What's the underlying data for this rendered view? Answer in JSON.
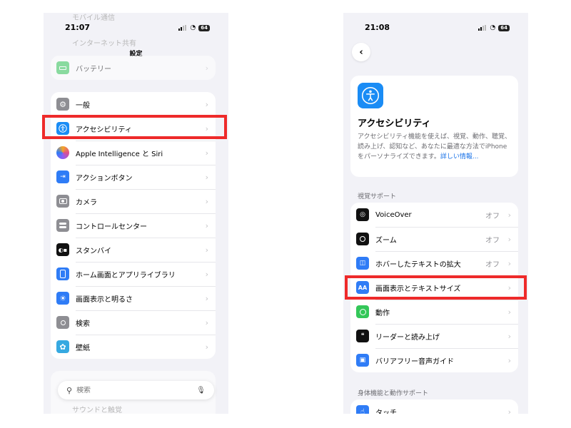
{
  "left_phone": {
    "status": {
      "time": "21:07",
      "battery": "64"
    },
    "faded_top": [
      "モバイル通信",
      "インターネット共有"
    ],
    "title": "設定",
    "battery_row": {
      "label": "バッテリー"
    },
    "groups": [
      {
        "label": "一般",
        "icon": "gear-icon",
        "color": "#8e8e93"
      },
      {
        "label": "アクセシビリティ",
        "icon": "accessibility-icon",
        "color": "#1a8cf5"
      },
      {
        "label": "Apple Intelligence と Siri",
        "icon": "siri-icon",
        "color": "#e04e8a"
      },
      {
        "label": "アクションボタン",
        "icon": "action-button-icon",
        "color": "#2f7cf6"
      },
      {
        "label": "カメラ",
        "icon": "camera-icon",
        "color": "#8e8e93"
      },
      {
        "label": "コントロールセンター",
        "icon": "control-center-icon",
        "color": "#8e8e93"
      },
      {
        "label": "スタンバイ",
        "icon": "standby-icon",
        "color": "#111111"
      },
      {
        "label": "ホーム画面とアプリライブラリ",
        "icon": "home-screen-icon",
        "color": "#2f7cf6"
      },
      {
        "label": "画面表示と明るさ",
        "icon": "brightness-icon",
        "color": "#2f7cf6"
      },
      {
        "label": "検索",
        "icon": "search-icon",
        "color": "#8e8e93"
      },
      {
        "label": "壁紙",
        "icon": "wallpaper-icon",
        "color": "#36a9e1"
      }
    ],
    "search": {
      "placeholder": "検索"
    },
    "faded_bottom": "サウンドと触覚"
  },
  "right_phone": {
    "status": {
      "time": "21:08",
      "battery": "64"
    },
    "hero": {
      "title": "アクセシビリティ",
      "description": "アクセシビリティ機能を使えば、視覚、動作、聴覚、読み上げ、認知など、あなたに最適な方法でiPhoneをパーソナライズできます。",
      "link": "詳しい情報..."
    },
    "vision_section": "視覚サポート",
    "vision_items": [
      {
        "label": "VoiceOver",
        "value": "オフ",
        "icon": "voiceover-icon",
        "color": "#111111"
      },
      {
        "label": "ズーム",
        "value": "オフ",
        "icon": "zoom-icon",
        "color": "#111111"
      },
      {
        "label": "ホバーしたテキストの拡大",
        "value": "オフ",
        "icon": "hover-text-icon",
        "color": "#2f7cf6"
      },
      {
        "label": "画面表示とテキストサイズ",
        "value": "",
        "icon": "text-size-icon",
        "color": "#2f7cf6"
      },
      {
        "label": "動作",
        "value": "",
        "icon": "motion-icon",
        "color": "#34c759"
      },
      {
        "label": "リーダーと読み上げ",
        "value": "",
        "icon": "spoken-content-icon",
        "color": "#111111"
      },
      {
        "label": "バリアフリー音声ガイド",
        "value": "",
        "icon": "audio-description-icon",
        "color": "#2f7cf6"
      }
    ],
    "physical_section": "身体機能と動作サポート",
    "physical_items": [
      {
        "label": "タッチ",
        "icon": "touch-icon",
        "color": "#2f7cf6"
      }
    ]
  },
  "colors": {
    "highlight": "#ee2a2a",
    "background": "#f2f2f7"
  }
}
